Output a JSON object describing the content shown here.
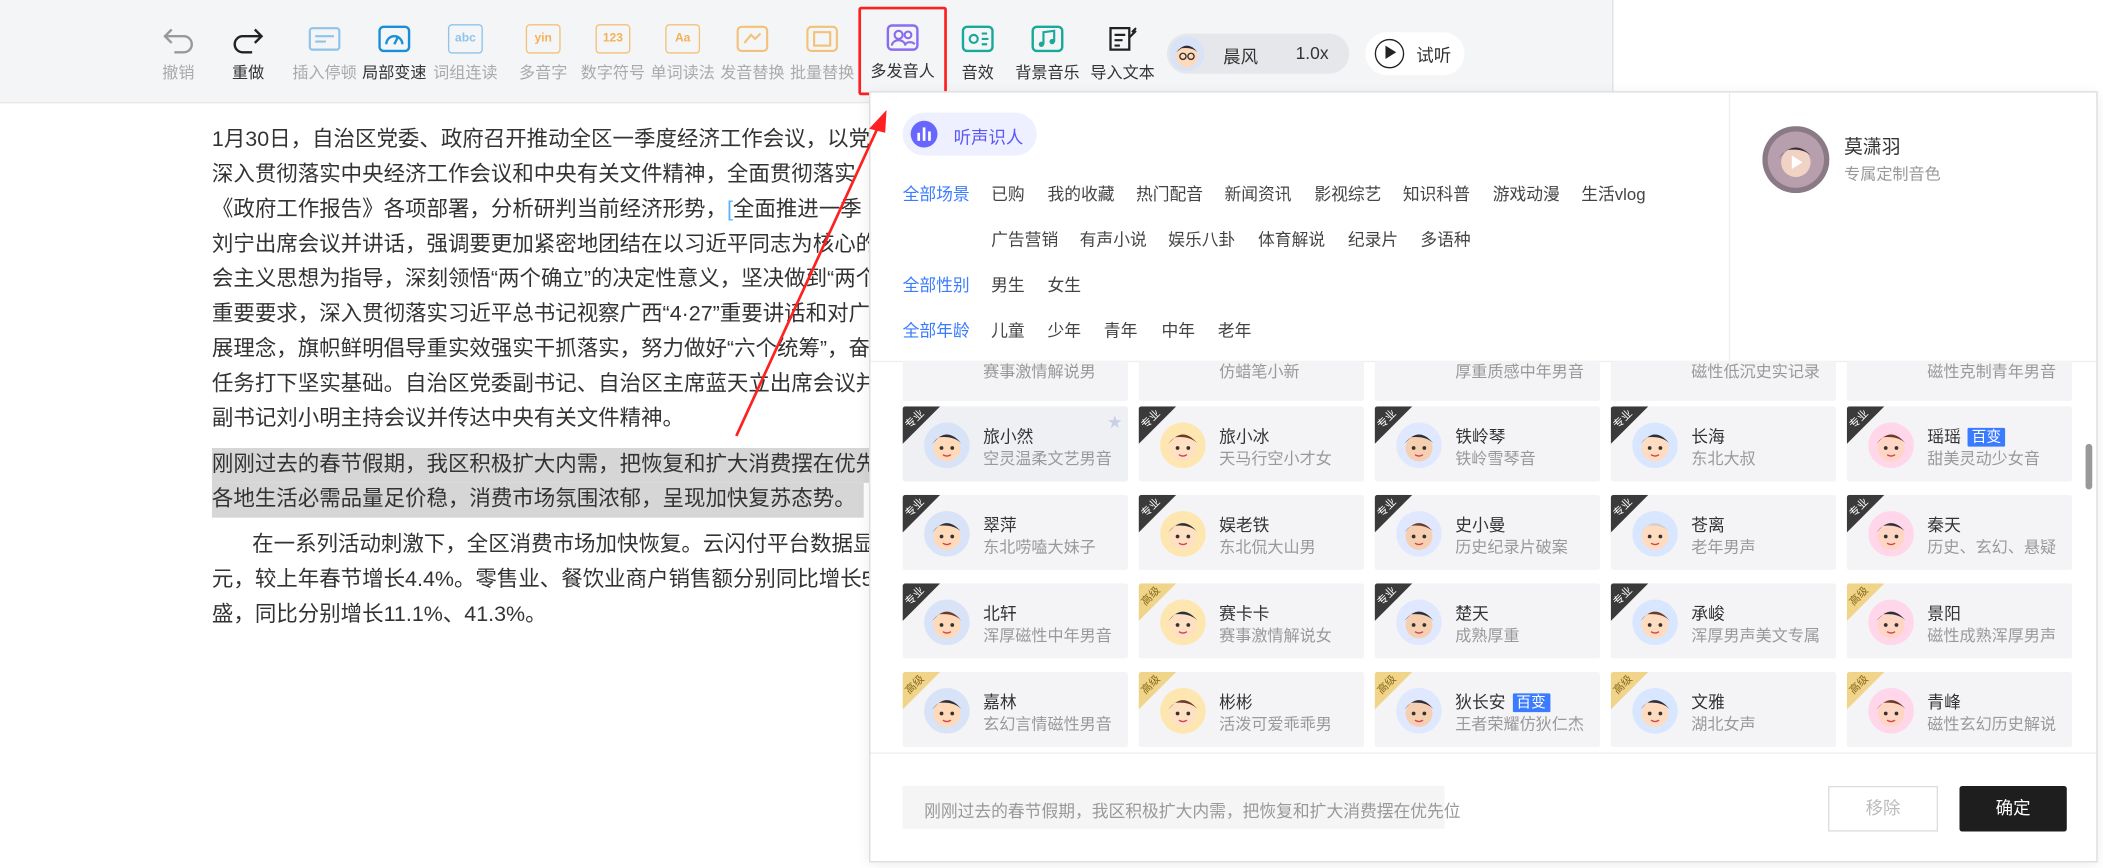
{
  "toolbar": {
    "items": [
      {
        "label": "撤销",
        "icon": "undo-icon",
        "state": "disabled"
      },
      {
        "label": "重做",
        "icon": "redo-icon",
        "state": "enabled"
      },
      {
        "label": "插入停顿",
        "icon": "insert-pause-icon",
        "state": "disabled"
      },
      {
        "label": "局部变速",
        "icon": "speed-gauge-icon",
        "state": "enabled"
      },
      {
        "label": "词组连读",
        "icon": "phrase-link-icon",
        "state": "disabled"
      },
      {
        "label": "多音字",
        "icon": "polyphone-icon",
        "state": "disabled"
      },
      {
        "label": "数字符号",
        "icon": "number-symbol-icon",
        "state": "disabled"
      },
      {
        "label": "单词读法",
        "icon": "word-reading-icon",
        "state": "disabled"
      },
      {
        "label": "发音替换",
        "icon": "pronunciation-replace-icon",
        "state": "disabled"
      },
      {
        "label": "批量替换",
        "icon": "batch-replace-icon",
        "state": "disabled"
      },
      {
        "label": "多发音人",
        "icon": "multi-speaker-icon",
        "state": "highlighted"
      },
      {
        "label": "音效",
        "icon": "sound-effect-icon",
        "state": "enabled"
      },
      {
        "label": "背景音乐",
        "icon": "background-music-icon",
        "state": "enabled"
      },
      {
        "label": "导入文本",
        "icon": "import-text-icon",
        "state": "enabled"
      }
    ],
    "speaker": {
      "name": "晨风",
      "speed": "1.0x"
    },
    "listen_label": "试听"
  },
  "document": {
    "p1": [
      "1月30日，自治区党委、政府召开推动全区一季度经济工作会议，以党",
      "深入贯彻落实中央经济工作会议和中央有关文件精神，全面贯彻落实",
      "《政府工作报告》各项部署，分析研判当前经济形势，",
      "全面推进一季",
      "刘宁出席会议并讲话，强调要更加紧密地团结在以习近平同志为核心的",
      "会主义思想为指导，深刻领悟“两个确立”的决定性意义，坚决做到“两个",
      "重要要求，深入贯彻落实习近平总书记视察广西“4·27”重要讲话和对广",
      "展理念，旗帜鲜明倡导重实效强实干抓落实，努力做好“六个统筹”，奋",
      "任务打下坚实基础。自治区党委副书记、自治区主席蓝天立出席会议并",
      "副书记刘小明主持会议并传达中央有关文件精神。"
    ],
    "p2": [
      "刚刚过去的春节假期，我区积极扩大内需，把恢复和扩大消费摆在优先",
      "各地生活必需品量足价稳，消费市场氛围浓郁，呈现加快复苏态势。"
    ],
    "p3": [
      "在一系列活动刺激下，全区消费市场加快恢复。云闪付平台数据显",
      "元，较上年春节增长4.4%。零售业、餐饮业商户销售额分别同比增长5",
      "盛，同比分别增长11.1%、41.3%。"
    ]
  },
  "panel": {
    "voiceprint_label": "听声识人",
    "featured": {
      "name": "莫潇羽",
      "desc": "专属定制音色"
    },
    "filters": {
      "scene_label": "全部场景",
      "scenes_row1": [
        "已购",
        "我的收藏",
        "热门配音",
        "新闻资讯",
        "影视综艺",
        "知识科普",
        "游戏动漫",
        "生活vlog"
      ],
      "scenes_row2": [
        "广告营销",
        "有声小说",
        "娱乐八卦",
        "体育解说",
        "纪录片",
        "多语种"
      ],
      "gender_label": "全部性别",
      "genders": [
        "男生",
        "女生"
      ],
      "age_label": "全部年龄",
      "ages": [
        "儿童",
        "少年",
        "青年",
        "中年",
        "老年"
      ]
    },
    "partial_row": [
      {
        "desc": "赛事激情解说男"
      },
      {
        "desc": "仿蜡笔小新"
      },
      {
        "desc": "厚重质感中年男音"
      },
      {
        "desc": "磁性低沉史实记录"
      },
      {
        "desc": "磁性克制青年男音"
      }
    ],
    "voices": [
      {
        "name": "旅小然",
        "desc": "空灵温柔文艺男音",
        "tag": "专业",
        "selected": true
      },
      {
        "name": "旅小冰",
        "desc": "天马行空小才女",
        "tag": "专业"
      },
      {
        "name": "铁岭琴",
        "desc": "铁岭雪琴音",
        "tag": "专业"
      },
      {
        "name": "长海",
        "desc": "东北大叔",
        "tag": "专业"
      },
      {
        "name": "瑶瑶",
        "desc": "甜美灵动少女音",
        "tag": "专业",
        "badge": "百变"
      },
      {
        "name": "翠萍",
        "desc": "东北唠嗑大妹子",
        "tag": "专业"
      },
      {
        "name": "娱老铁",
        "desc": "东北侃大山男",
        "tag": "专业"
      },
      {
        "name": "史小曼",
        "desc": "历史纪录片破案",
        "tag": "专业"
      },
      {
        "name": "苍离",
        "desc": "老年男声",
        "tag": "专业"
      },
      {
        "name": "秦天",
        "desc": "历史、玄幻、悬疑",
        "tag": "专业"
      },
      {
        "name": "北轩",
        "desc": "浑厚磁性中年男音",
        "tag": "专业"
      },
      {
        "name": "赛卡卡",
        "desc": "赛事激情解说女",
        "tag": "高级"
      },
      {
        "name": "楚天",
        "desc": "成熟厚重",
        "tag": "专业"
      },
      {
        "name": "承峻",
        "desc": "浑厚男声美文专属",
        "tag": "专业"
      },
      {
        "name": "景阳",
        "desc": "磁性成熟浑厚男声",
        "tag": "高级"
      },
      {
        "name": "嘉林",
        "desc": "玄幻言情磁性男音",
        "tag": "高级"
      },
      {
        "name": "彬彬",
        "desc": "活泼可爱乖乖男",
        "tag": "高级"
      },
      {
        "name": "狄长安",
        "desc": "王者荣耀仿狄仁杰",
        "tag": "高级",
        "badge": "百变"
      },
      {
        "name": "文雅",
        "desc": "湖北女声",
        "tag": "高级"
      },
      {
        "name": "青峰",
        "desc": "磁性玄幻历史解说",
        "tag": "高级"
      }
    ],
    "preview_text": "刚刚过去的春节假期，我区积极扩大内需，把恢复和扩大消费摆在优先位",
    "remove_label": "移除",
    "confirm_label": "确定"
  },
  "colors": {
    "accent_blue": "#3a7bff",
    "highlight_red": "#ff1f1f",
    "brand_purple": "#6966ff",
    "teal": "#1aa89a"
  }
}
